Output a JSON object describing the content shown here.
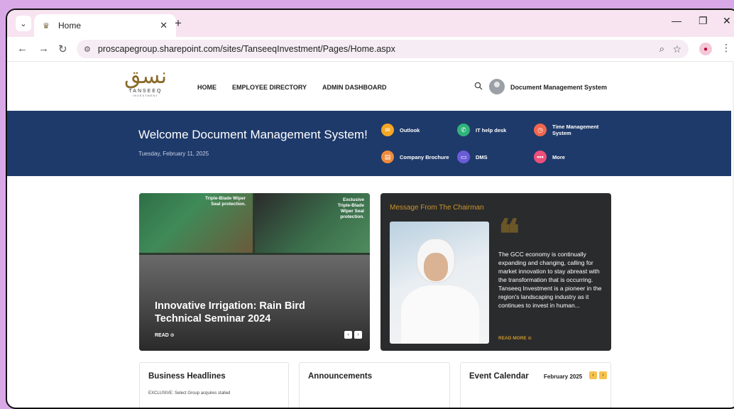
{
  "browser": {
    "tab_title": "Home",
    "url": "proscapegroup.sharepoint.com/sites/TanseeqInvestment/Pages/Home.aspx"
  },
  "site": {
    "logo_word": "TANSEEQ",
    "logo_sub": "INVESTMENT",
    "nav": [
      "HOME",
      "EMPLOYEE DIRECTORY",
      "ADMIN DASHBOARD"
    ],
    "user_name": "Document Management System"
  },
  "banner": {
    "welcome": "Welcome Document  Management System!",
    "date": "Tuesday, February 11, 2025",
    "quick_links": [
      {
        "label": "Outlook",
        "icon": "outlook-icon",
        "color": "#f5a623"
      },
      {
        "label": "IT help desk",
        "icon": "phone-icon",
        "color": "#2fb37a"
      },
      {
        "label": "Time Management System",
        "icon": "clock-icon",
        "color": "#f0664e"
      },
      {
        "label": "Company Brochure",
        "icon": "document-icon",
        "color": "#f08a3c"
      },
      {
        "label": "DMS",
        "icon": "monitor-icon",
        "color": "#6a5bd8"
      },
      {
        "label": "More",
        "icon": "more-icon",
        "color": "#ee4f7a"
      }
    ]
  },
  "hero": {
    "photo_text_1": "Triple-Blade Wiper Seal protection.",
    "photo_text_2": "Exclusive Triple-Blade Wiper Seal protection.",
    "title": "Innovative Irrigation: Rain Bird Technical Seminar 2024",
    "read_label": "READ"
  },
  "chairman": {
    "heading": "Message From The Chairman",
    "text": "The GCC economy is continually expanding and changing, calling for market innovation to stay abreast with the transformation that is occurring. Tanseeq Investment is a pioneer in the region's landscaping industry as it continues to invest in human...",
    "read_more": "READ MORE"
  },
  "cards": {
    "headlines_title": "Business Headlines",
    "headlines_first": "EXCLUSIVE: Select Group acquires stalled",
    "announcements_title": "Announcements",
    "calendar_title": "Event Calendar",
    "calendar_month": "February 2025"
  }
}
